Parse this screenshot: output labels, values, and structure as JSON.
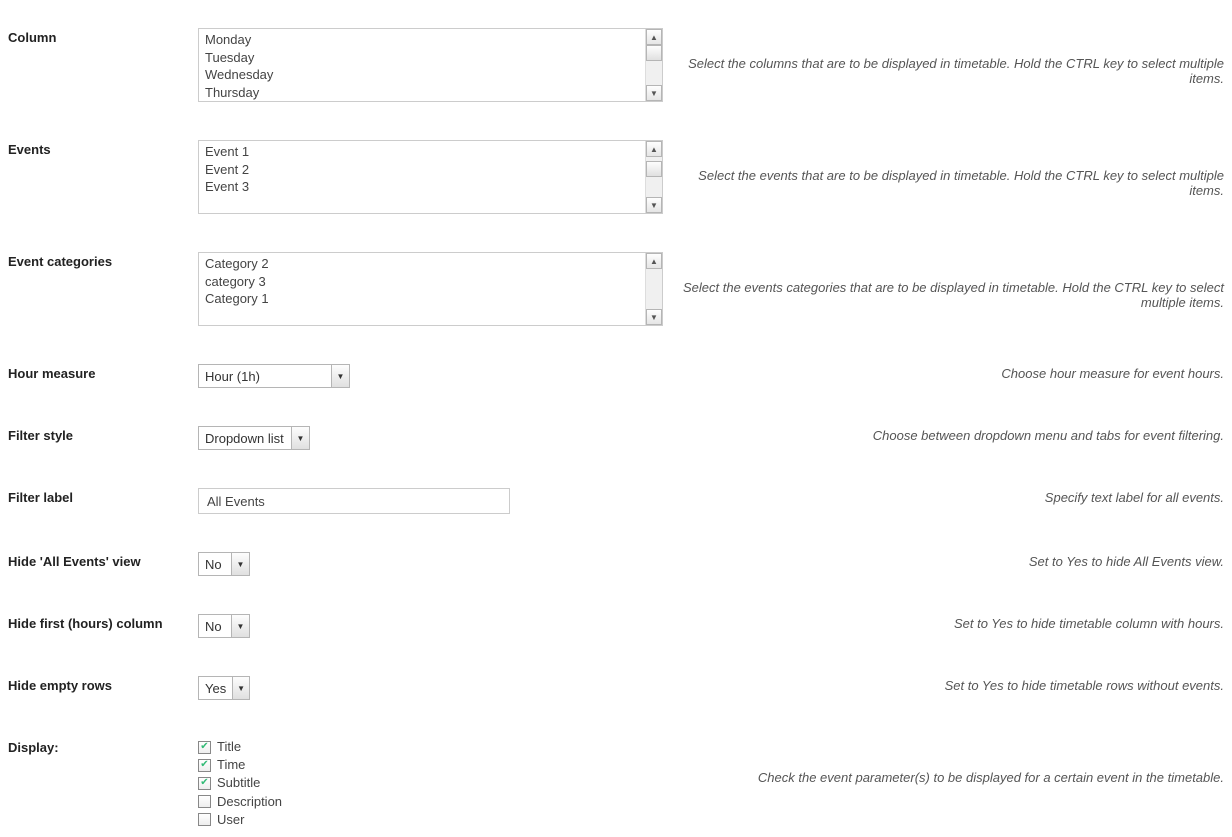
{
  "rows": {
    "column": {
      "label": "Column",
      "options": [
        "",
        "Monday",
        "Tuesday",
        "Wednesday",
        "Thursday"
      ],
      "desc": "Select the columns that are to be displayed in timetable. Hold the CTRL key to select multiple items."
    },
    "events": {
      "label": "Events",
      "options": [
        "",
        "Event 1",
        "Event 2",
        "Event 3"
      ],
      "desc": "Select the events that are to be displayed in timetable. Hold the CTRL key to select multiple items."
    },
    "categories": {
      "label": "Event categories",
      "options": [
        "Category 2",
        "category 3",
        "Category 1",
        ""
      ],
      "desc": "Select the events categories that are to be displayed in timetable. Hold the CTRL key to select multiple items."
    },
    "hour_measure": {
      "label": "Hour measure",
      "value": "Hour (1h)",
      "desc": "Choose hour measure for event hours."
    },
    "filter_style": {
      "label": "Filter style",
      "value": "Dropdown list",
      "desc": "Choose between dropdown menu and tabs for event filtering."
    },
    "filter_label": {
      "label": "Filter label",
      "value": "All Events",
      "desc": "Specify text label for all events."
    },
    "hide_all_events": {
      "label": "Hide 'All Events' view",
      "value": "No",
      "desc": "Set to Yes to hide All Events view."
    },
    "hide_first_col": {
      "label": "Hide first (hours) column",
      "value": "No",
      "desc": "Set to Yes to hide timetable column with hours."
    },
    "hide_empty_rows": {
      "label": "Hide empty rows",
      "value": "Yes",
      "desc": "Set to Yes to hide timetable rows without events."
    },
    "display": {
      "label": "Display:",
      "items": [
        {
          "label": "Title",
          "checked": true
        },
        {
          "label": "Time",
          "checked": true
        },
        {
          "label": "Subtitle",
          "checked": true
        },
        {
          "label": "Description",
          "checked": false
        },
        {
          "label": "User",
          "checked": false
        }
      ],
      "desc": "Check the event parameter(s) to be displayed for a certain event in the timetable."
    }
  }
}
